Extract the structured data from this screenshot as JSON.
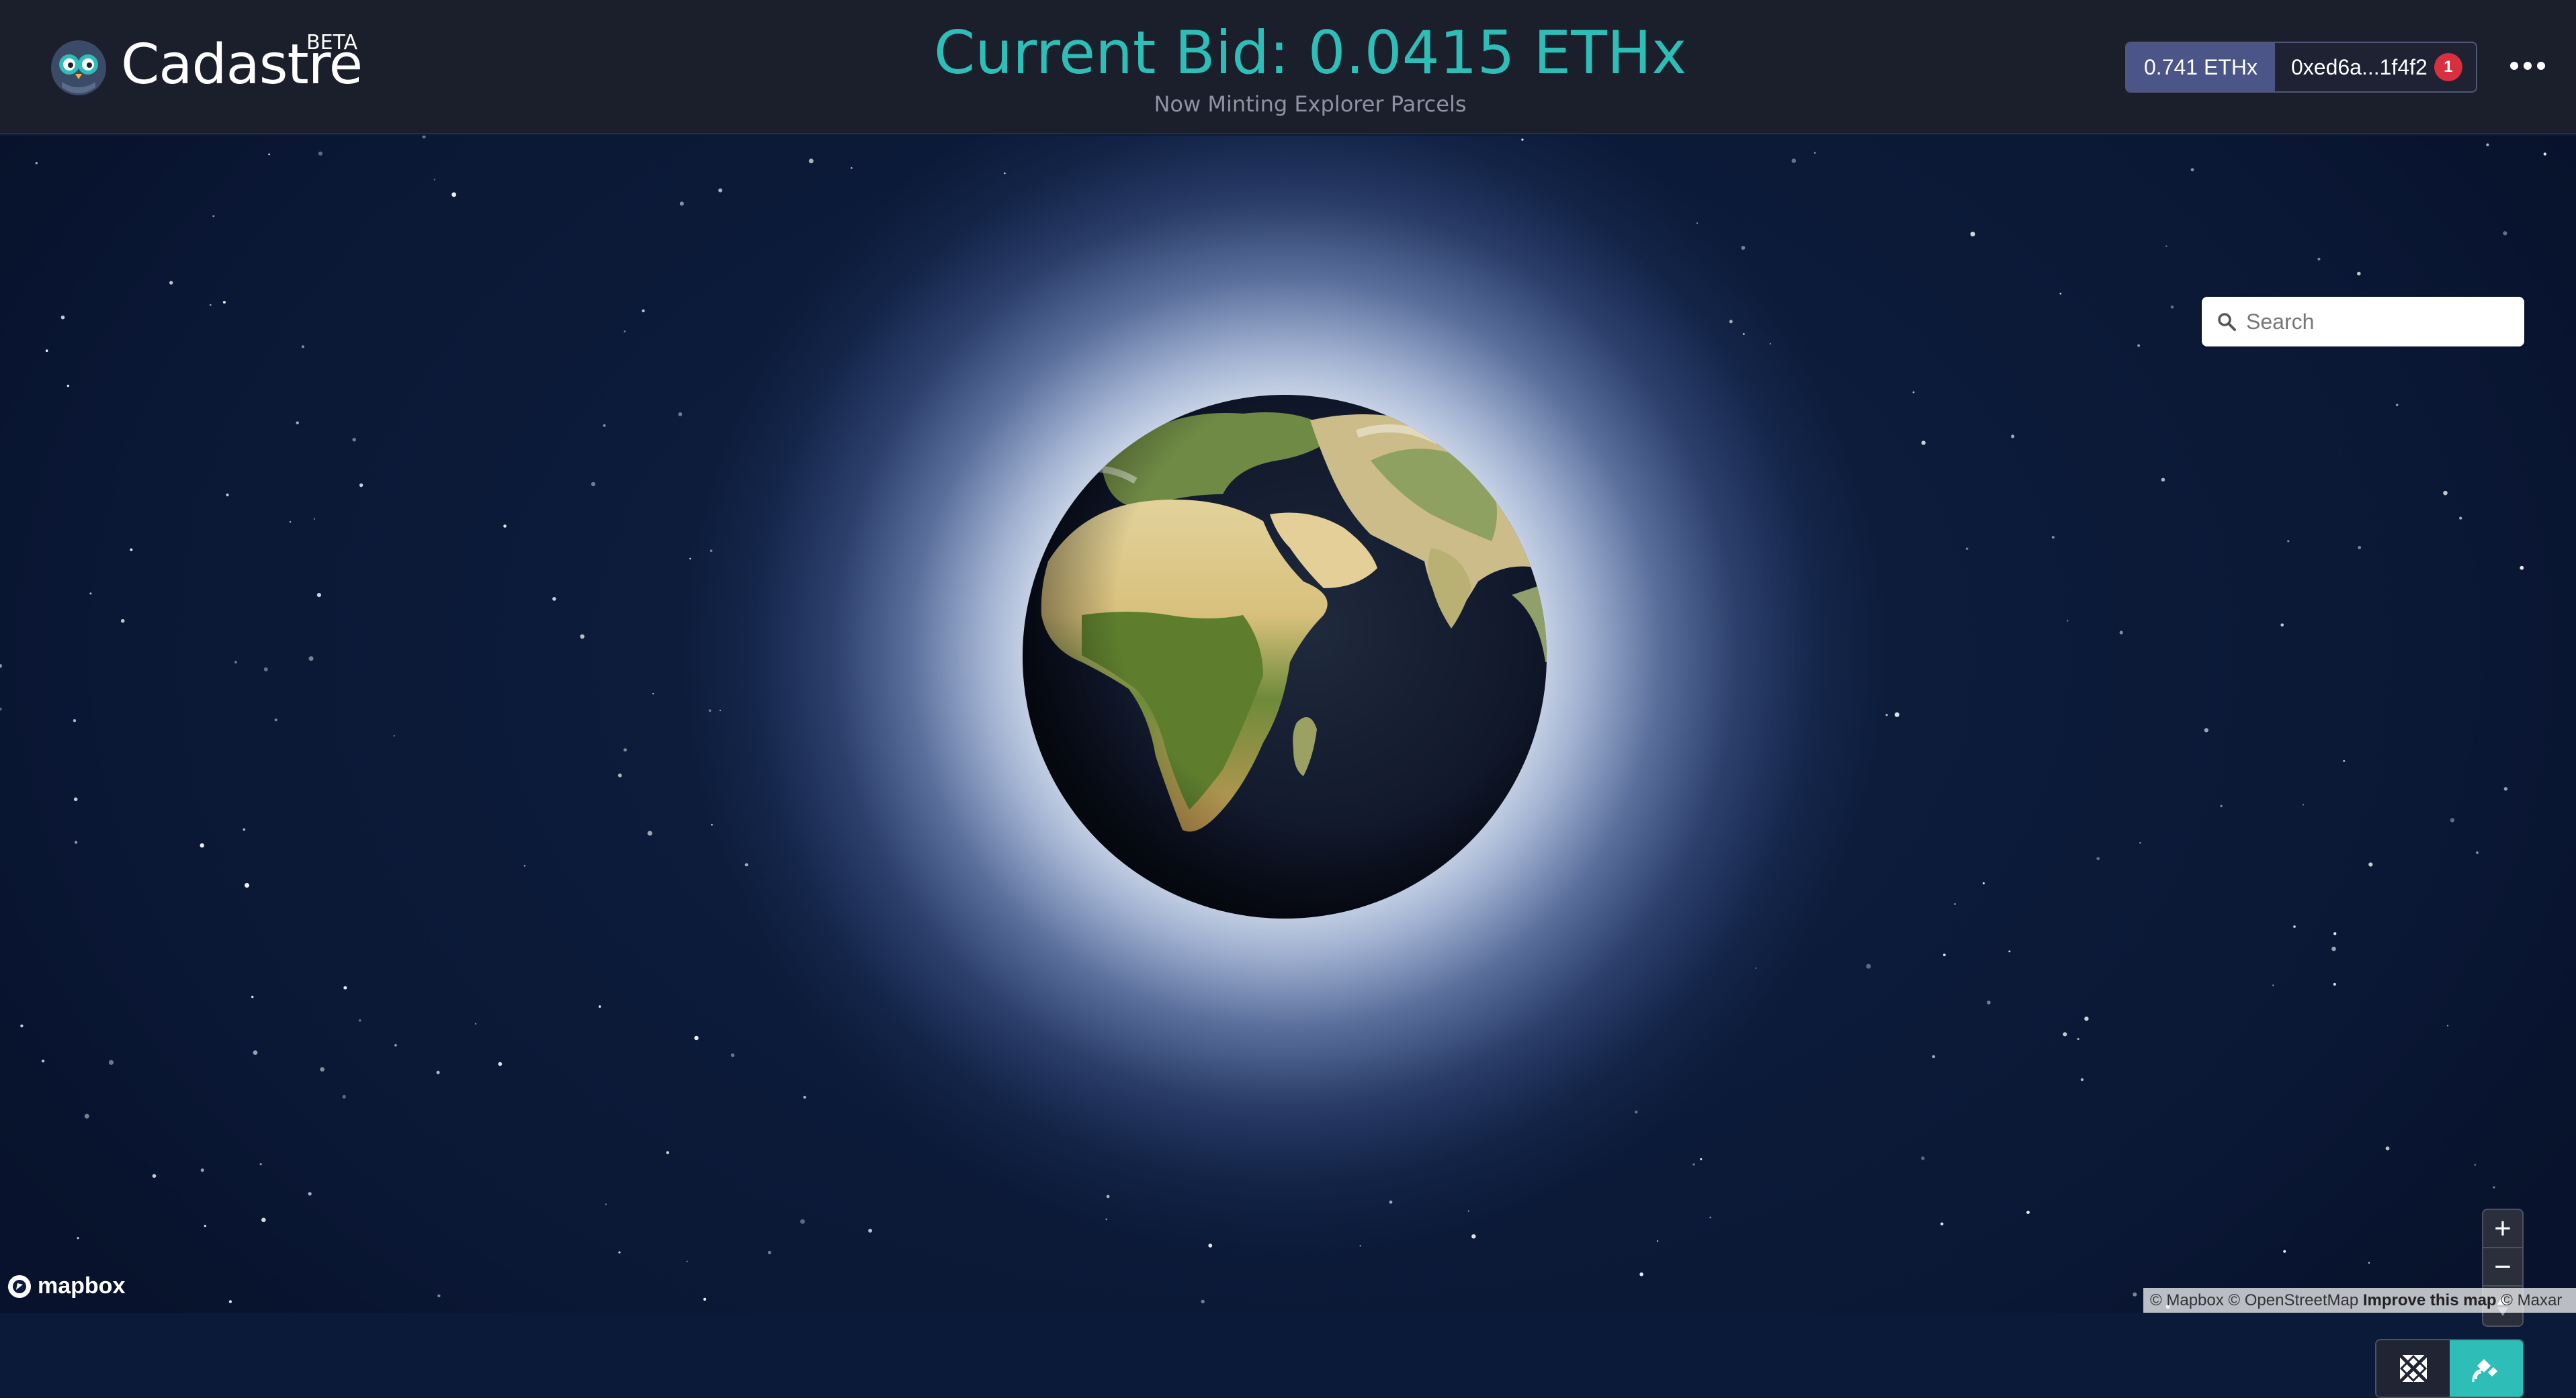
{
  "header": {
    "brand": "Cadastre",
    "badge": "BETA",
    "current_bid": "Current Bid: 0.0415 ETHx",
    "subtitle": "Now Minting Explorer Parcels"
  },
  "wallet": {
    "balance": "0.741 ETHx",
    "address": "0xed6a...1f4f2",
    "notification_count": "1"
  },
  "map": {
    "search": {
      "placeholder": "Search",
      "value": ""
    },
    "controls": {
      "zoom_in": "+",
      "zoom_out": "−",
      "compass": "compass-icon"
    },
    "style_toggle": {
      "options": [
        "satellite-off-icon",
        "satellite-icon"
      ],
      "active": "satellite-icon"
    },
    "logo": "mapbox",
    "attribution": {
      "part1": "© Mapbox © OpenStreetMap",
      "improve": "Improve this map",
      "part2": "© Maxar"
    }
  },
  "colors": {
    "accent": "#2ebdb7",
    "header_bg": "#1b1e2b",
    "balance_bg": "#4b5588",
    "badge_red": "#d9303f"
  },
  "icons": [
    "owl-logo-icon",
    "more-dots-icon",
    "search-icon",
    "plus-icon",
    "minus-icon",
    "compass-icon",
    "satellite-off-icon",
    "satellite-icon",
    "mapbox-logo-icon"
  ]
}
